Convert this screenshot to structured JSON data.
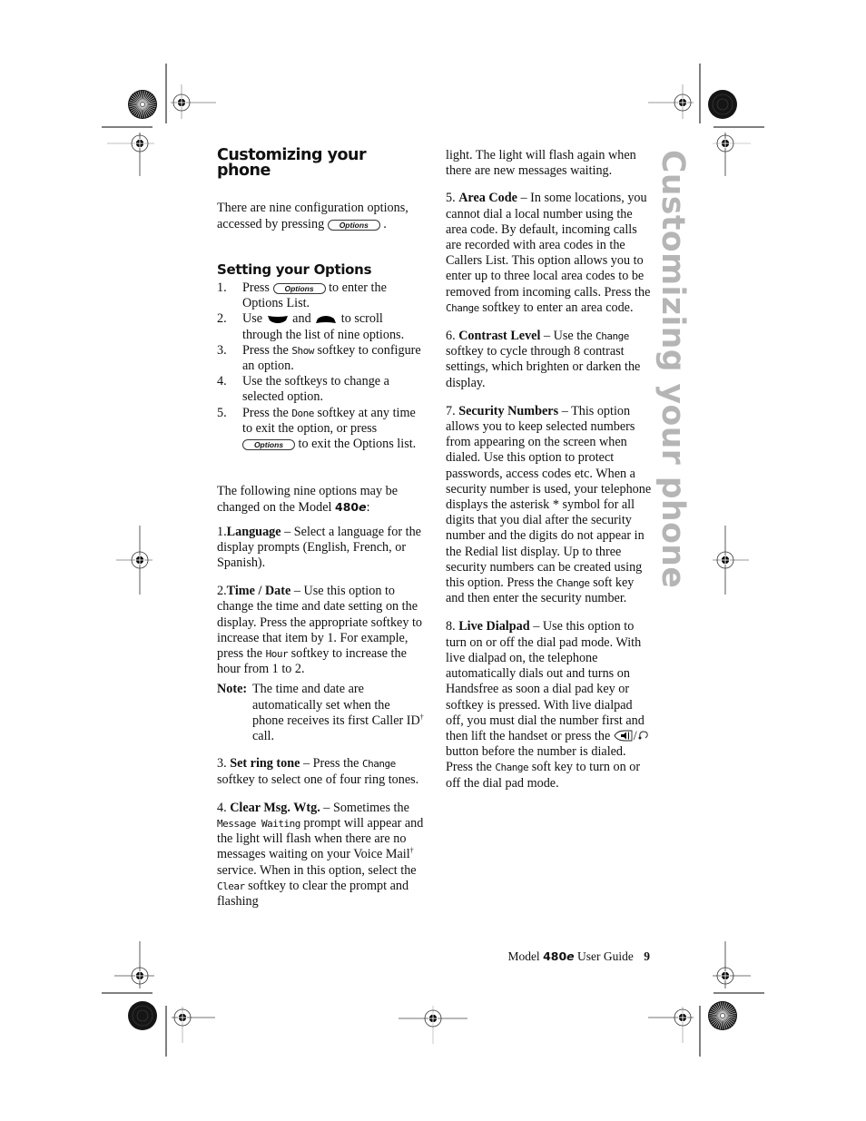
{
  "page": {
    "heading": "Customizing your phone",
    "side_tab": "Customizing your phone",
    "intro": {
      "before": "There are nine configuration options, accessed by pressing",
      "key": "Options",
      "after": "."
    },
    "setting": {
      "heading": "Setting your Options",
      "steps": [
        {
          "num": "1.",
          "pre": "Press",
          "key": "Options",
          "post": "to enter the Options List."
        },
        {
          "num": "2.",
          "pre": "Use",
          "mid": "and",
          "post": "to scroll through the list of nine options."
        },
        {
          "num": "3.",
          "pre": "Press the",
          "lcd": "Show",
          "post": "softkey to configure an option."
        },
        {
          "num": "4.",
          "text": "Use the softkeys to change a selected option."
        },
        {
          "num": "5.",
          "pre": "Press the",
          "lcd": "Done",
          "post": "softkey at any time to exit the option, or press",
          "key": "Options",
          "post2": "to exit the Options list."
        }
      ]
    },
    "following": {
      "pre": "The following nine options may be changed on the Model",
      "model": "480",
      "model_suffix": "e",
      "post": ":"
    },
    "options": [
      {
        "num": "1.",
        "name": "Language",
        "text": " – Select a language for the display prompts (English, French, or Spanish)."
      },
      {
        "num": "2.",
        "name": "Time / Date",
        "text_pre": " – Use this option to change the time and date setting on the display. Press the appropriate softkey to increase that item by 1. For example, press the",
        "lcd": "Hour",
        "text_post": "softkey to increase the hour from 1 to 2."
      },
      {
        "num": "3. ",
        "name": "Set ring tone",
        "text_pre": " – Press the",
        "lcd": "Change",
        "text_post": "softkey to select one of four ring tones."
      },
      {
        "num": "4. ",
        "name": "Clear Msg. Wtg.",
        "text_pre": " – Sometimes the",
        "lcd": "Message Waiting",
        "text_mid": "prompt will appear and the light will flash when there are no messages waiting on your Voice Mail",
        "text_mid2": " service. When in this option, select the",
        "lcd2": "Clear",
        "text_post": "softkey to clear the prompt and flashing",
        "continued": "light.  The light will flash again when there are new messages waiting."
      },
      {
        "num": "5. ",
        "name": "Area Code",
        "text_pre": " – In some locations, you cannot dial a local number using the area code. By default, incoming calls are recorded with area codes in the Callers List. This option allows you to enter up to three local area codes to be removed from incoming calls. Press the",
        "lcd": "Change",
        "text_post": "softkey to enter an area code."
      },
      {
        "num": "6. ",
        "name": "Contrast Level",
        "text_pre": " – Use the",
        "lcd": "Change",
        "text_post": "softkey to cycle through 8 contrast settings, which brighten or darken the display."
      },
      {
        "num": "7. ",
        "name": "Security Numbers",
        "text_pre": " –  This option allows you to keep selected numbers from appearing on the screen when dialed.  Use this option to protect passwords, access codes etc.   When a security number is used, your telephone displays the asterisk * symbol for all digits that you dial after the security number and the digits do not appear in the Redial list display.  Up to three security numbers can be created using this option. Press the",
        "lcd": "Change",
        "text_post": "soft key and then enter the security number."
      },
      {
        "num": "8. ",
        "name": "Live Dialpad",
        "text_pre": " – Use this option to turn on or off the dial pad mode. With live dialpad on, the telephone automatically dials out and turns on Handsfree as soon a dial pad key or softkey is pressed.  With live dialpad off, you must dial the number first and then lift the handset or press the",
        "icon_sep": "/",
        "text_mid": "button before the number is dialed. Press the",
        "lcd": "Change",
        "text_post": "soft key to turn on or off the dial pad mode."
      }
    ],
    "note": {
      "label": "Note:",
      "text": "The time and date are automatically set when the phone receives its first Caller ID",
      "dagger": "†",
      "after": " call."
    },
    "dagger": "†",
    "footer": {
      "pre": "Model",
      "model": "480",
      "model_suffix": "e",
      "post": "User Guide",
      "page_number": "9"
    }
  }
}
